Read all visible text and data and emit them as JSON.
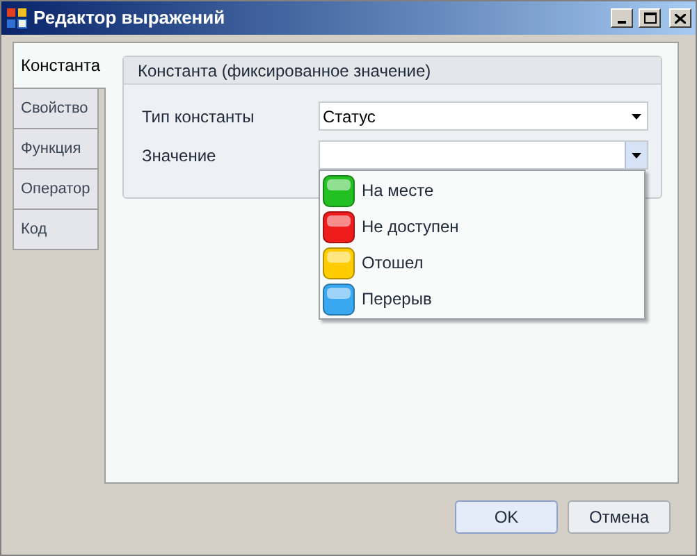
{
  "window": {
    "title": "Редактор выражений"
  },
  "tabs": [
    {
      "label": "Константа",
      "selected": true
    },
    {
      "label": "Свойство",
      "selected": false
    },
    {
      "label": "Функция",
      "selected": false
    },
    {
      "label": "Оператор",
      "selected": false
    },
    {
      "label": "Код",
      "selected": false
    }
  ],
  "group": {
    "title": "Константа (фиксированное значение)",
    "fields": [
      {
        "label": "Тип константы",
        "value": "Статус"
      },
      {
        "label": "Значение"
      }
    ]
  },
  "dropdown": {
    "expanded": true,
    "options": [
      {
        "label": "На месте",
        "color": "#22c022"
      },
      {
        "label": "Не доступен",
        "color": "#ee1c1c"
      },
      {
        "label": "Отошел",
        "color": "#ffcc00"
      },
      {
        "label": "Перерыв",
        "color": "#3aa8f0"
      }
    ]
  },
  "buttons": [
    {
      "label": "OK",
      "selected": true
    },
    {
      "label": "Отмена",
      "selected": false
    }
  ]
}
